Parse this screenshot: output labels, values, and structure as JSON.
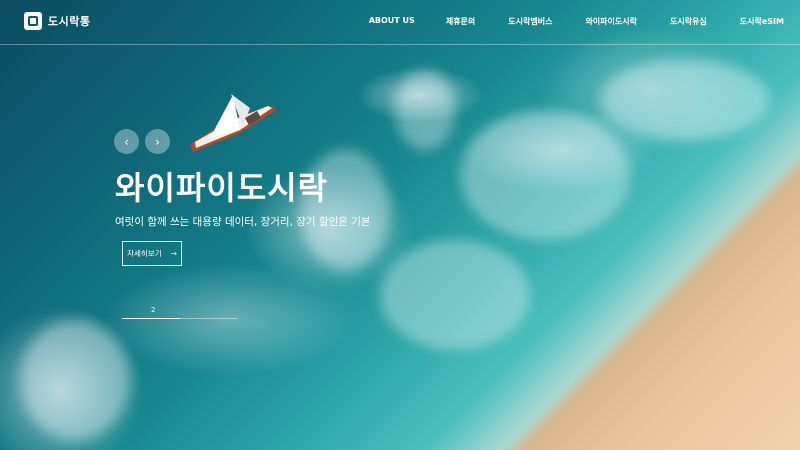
{
  "header": {
    "logo_text": "도시락통",
    "logo_icon": "wifi-box-icon",
    "nav": [
      {
        "label": "ABOUT US"
      },
      {
        "label": "제휴문의"
      },
      {
        "label": "도시락멤버스"
      },
      {
        "label": "와이파이도시락"
      },
      {
        "label": "도시락유심"
      },
      {
        "label": "도시락eSIM"
      }
    ]
  },
  "hero": {
    "title": "와이파이도시락",
    "subtitle": "여럿이 함께 쓰는 대용량 데이터, 장거리, 장기 할인은 기본",
    "more_label": "자세히보기",
    "more_icon": "arrow-right-icon",
    "prev_icon": "chevron-left-icon",
    "next_icon": "chevron-right-icon",
    "prev_glyph": "‹",
    "next_glyph": "›",
    "arrow_glyph": "→",
    "slide_number": "2",
    "slide_progress": 0.5
  }
}
